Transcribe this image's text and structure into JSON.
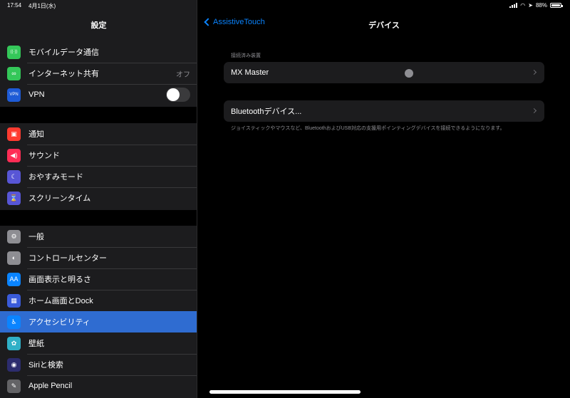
{
  "status_bar": {
    "time": "17:54",
    "date": "4月1日(水)",
    "battery": "88%"
  },
  "sidebar": {
    "title": "設定",
    "groups": [
      {
        "items": [
          {
            "label": "モバイルデータ通信",
            "icon": "antenna-icon",
            "color": "#34c759",
            "glyph": "((·))"
          },
          {
            "label": "インターネット共有",
            "icon": "link-icon",
            "color": "#34c759",
            "glyph": "∞",
            "value": "オフ"
          },
          {
            "label": "VPN",
            "icon": "vpn-icon",
            "color": "#1e5bd6",
            "glyph": "VPN",
            "toggle": "off"
          }
        ]
      },
      {
        "items": [
          {
            "label": "通知",
            "icon": "notifications-icon",
            "color": "#ff3b30",
            "glyph": "▣"
          },
          {
            "label": "サウンド",
            "icon": "speaker-icon",
            "color": "#ff2d55",
            "glyph": "◀)"
          },
          {
            "label": "おやすみモード",
            "icon": "moon-icon",
            "color": "#5856d6",
            "glyph": "☾"
          },
          {
            "label": "スクリーンタイム",
            "icon": "hourglass-icon",
            "color": "#5856d6",
            "glyph": "⌛"
          }
        ]
      },
      {
        "items": [
          {
            "label": "一般",
            "icon": "gear-icon",
            "color": "#8e8e93",
            "glyph": "⚙"
          },
          {
            "label": "コントロールセンター",
            "icon": "switches-icon",
            "color": "#8e8e93",
            "glyph": "◐"
          },
          {
            "label": "画面表示と明るさ",
            "icon": "text-size-icon",
            "color": "#0a84ff",
            "glyph": "AA"
          },
          {
            "label": "ホーム画面とDock",
            "icon": "home-grid-icon",
            "color": "#3a5bd9",
            "glyph": "▦"
          },
          {
            "label": "アクセシビリティ",
            "icon": "accessibility-icon",
            "color": "#0a84ff",
            "glyph": "♿",
            "selected": true
          },
          {
            "label": "壁紙",
            "icon": "flower-icon",
            "color": "#30b0c7",
            "glyph": "✿"
          },
          {
            "label": "Siriと検索",
            "icon": "siri-icon",
            "color": "#2c2c6e",
            "glyph": "◉"
          },
          {
            "label": "Apple Pencil",
            "icon": "pencil-icon",
            "color": "#636366",
            "glyph": "✎"
          }
        ]
      }
    ]
  },
  "main": {
    "back_label": "AssistiveTouch",
    "title": "デバイス",
    "section_header": "接続済み装置",
    "connected_device": "MX Master",
    "bluetooth_label": "Bluetoothデバイス...",
    "footer": "ジョイスティックやマウスなど、BluetoothおよびUSB対応の支援用ポインティングデバイスを接続できるようになります。"
  }
}
